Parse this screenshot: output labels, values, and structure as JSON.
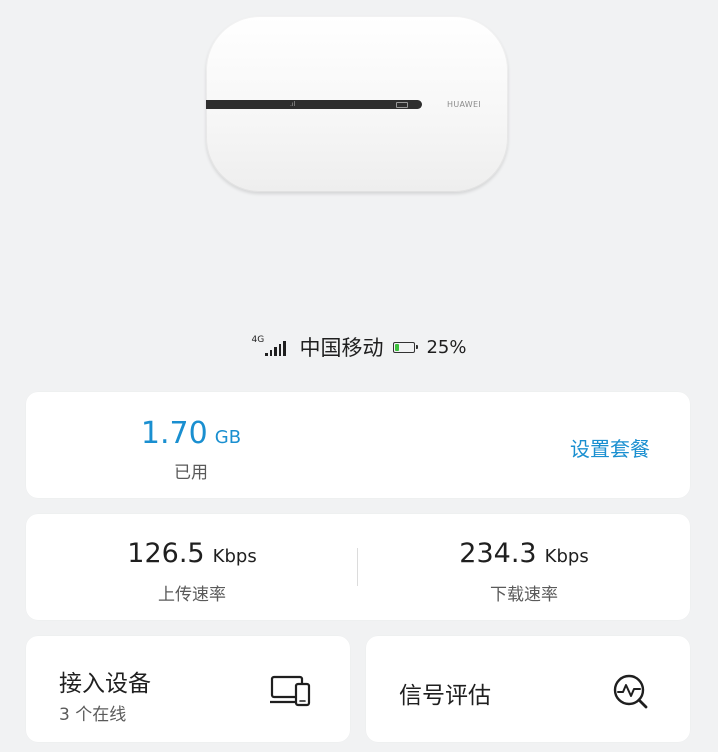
{
  "device": {
    "brand": "HUAWEI"
  },
  "status": {
    "network_type": "4G",
    "carrier": "中国移动",
    "battery_percent_text": "25%",
    "battery_level": 0.25,
    "battery_color": "#3bbf3b"
  },
  "usage": {
    "value": "1.70",
    "unit": "GB",
    "label": "已用",
    "plan_link": "设置套餐",
    "accent_color": "#1a8fd0"
  },
  "rates": {
    "upload": {
      "value": "126.5",
      "unit": "Kbps",
      "label": "上传速率"
    },
    "download": {
      "value": "234.3",
      "unit": "Kbps",
      "label": "下载速率"
    }
  },
  "tiles": {
    "devices": {
      "title": "接入设备",
      "subtitle": "3 个在线",
      "icon": "devices-icon"
    },
    "signal": {
      "title": "信号评估",
      "icon": "signal-check-icon"
    }
  }
}
